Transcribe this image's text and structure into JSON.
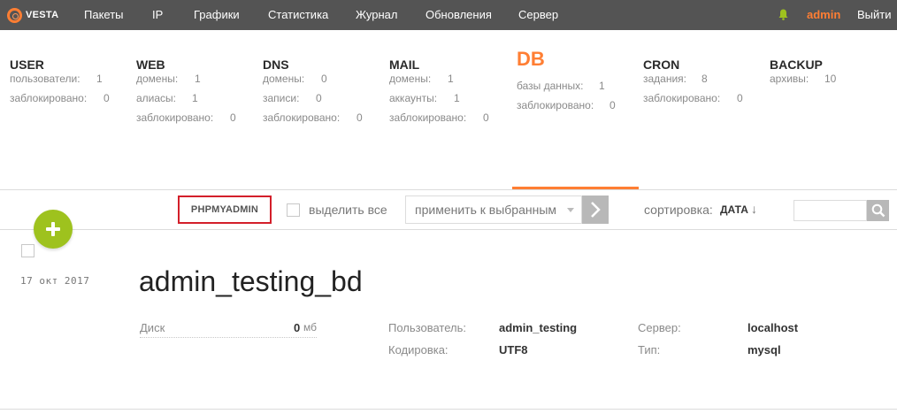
{
  "topbar": {
    "logo_text": "VESTA",
    "nav": [
      "Пакеты",
      "IP",
      "Графики",
      "Статистика",
      "Журнал",
      "Обновления",
      "Сервер"
    ],
    "user": "admin",
    "logout": "Выйти"
  },
  "stats": [
    {
      "title": "USER",
      "active": false,
      "rows": [
        {
          "label": "пользователи:",
          "value": "1"
        },
        {
          "label": "заблокировано:",
          "value": "0"
        }
      ]
    },
    {
      "title": "WEB",
      "active": false,
      "rows": [
        {
          "label": "домены:",
          "value": "1"
        },
        {
          "label": "алиасы:",
          "value": "1"
        },
        {
          "label": "заблокировано:",
          "value": "0"
        }
      ]
    },
    {
      "title": "DNS",
      "active": false,
      "rows": [
        {
          "label": "домены:",
          "value": "0"
        },
        {
          "label": "записи:",
          "value": "0"
        },
        {
          "label": "заблокировано:",
          "value": "0"
        }
      ]
    },
    {
      "title": "MAIL",
      "active": false,
      "rows": [
        {
          "label": "домены:",
          "value": "1"
        },
        {
          "label": "аккаунты:",
          "value": "1"
        },
        {
          "label": "заблокировано:",
          "value": "0"
        }
      ]
    },
    {
      "title": "DB",
      "active": true,
      "rows": [
        {
          "label": "базы данных:",
          "value": "1"
        },
        {
          "label": "заблокировано:",
          "value": "0"
        }
      ]
    },
    {
      "title": "CRON",
      "active": false,
      "rows": [
        {
          "label": "задания:",
          "value": "8"
        },
        {
          "label": "заблокировано:",
          "value": "0"
        }
      ]
    },
    {
      "title": "BACKUP",
      "active": false,
      "rows": [
        {
          "label": "архивы:",
          "value": "10"
        }
      ]
    }
  ],
  "toolbar": {
    "phpmyadmin": "PHPMYADMIN",
    "select_all": "выделить все",
    "bulk_action": "применить к выбранным",
    "sort_label": "сортировка:",
    "sort_value": "ДАТА",
    "sort_arrow": "↓"
  },
  "record": {
    "date": "17  окт  2017",
    "title": "admin_testing_bd",
    "disk_label": "Диск",
    "disk_value": "0",
    "disk_unit": "мб",
    "user_label": "Пользователь:",
    "user_value": "admin_testing",
    "encoding_label": "Кодировка:",
    "encoding_value": "UTF8",
    "server_label": "Сервер:",
    "server_value": "localhost",
    "type_label": "Тип:",
    "type_value": "mysql"
  },
  "colors": {
    "accent": "#ff7e33",
    "add_button": "#9ec21e",
    "highlight_border": "#d31f2a",
    "topbar": "#545454"
  },
  "icons": {
    "logo": "vesta-ring-logo",
    "bell": "bell-icon",
    "add": "plus-icon",
    "apply": "chevron-right-icon",
    "search": "search-icon"
  }
}
